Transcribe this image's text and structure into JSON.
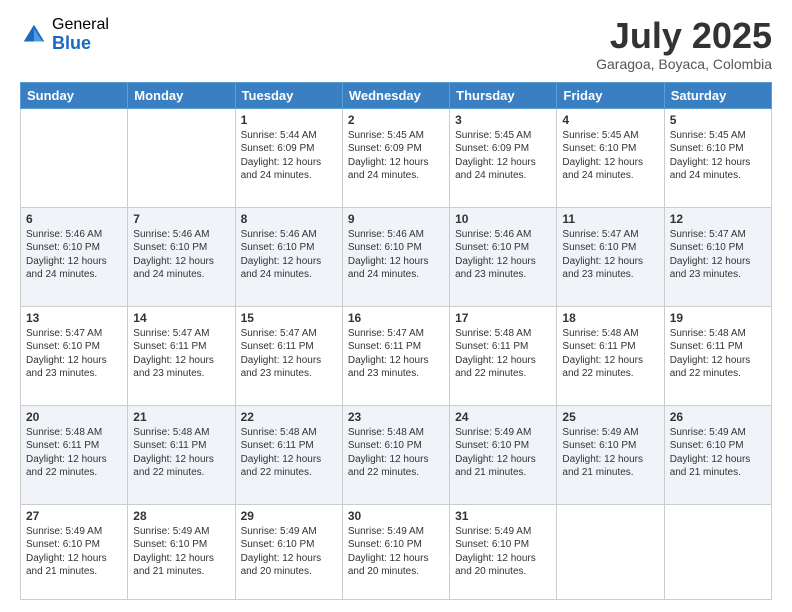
{
  "logo": {
    "general": "General",
    "blue": "Blue"
  },
  "header": {
    "month": "July 2025",
    "location": "Garagoa, Boyaca, Colombia"
  },
  "days_of_week": [
    "Sunday",
    "Monday",
    "Tuesday",
    "Wednesday",
    "Thursday",
    "Friday",
    "Saturday"
  ],
  "weeks": [
    [
      {
        "day": "",
        "info": ""
      },
      {
        "day": "",
        "info": ""
      },
      {
        "day": "1",
        "info": "Sunrise: 5:44 AM\nSunset: 6:09 PM\nDaylight: 12 hours and 24 minutes."
      },
      {
        "day": "2",
        "info": "Sunrise: 5:45 AM\nSunset: 6:09 PM\nDaylight: 12 hours and 24 minutes."
      },
      {
        "day": "3",
        "info": "Sunrise: 5:45 AM\nSunset: 6:09 PM\nDaylight: 12 hours and 24 minutes."
      },
      {
        "day": "4",
        "info": "Sunrise: 5:45 AM\nSunset: 6:10 PM\nDaylight: 12 hours and 24 minutes."
      },
      {
        "day": "5",
        "info": "Sunrise: 5:45 AM\nSunset: 6:10 PM\nDaylight: 12 hours and 24 minutes."
      }
    ],
    [
      {
        "day": "6",
        "info": "Sunrise: 5:46 AM\nSunset: 6:10 PM\nDaylight: 12 hours and 24 minutes."
      },
      {
        "day": "7",
        "info": "Sunrise: 5:46 AM\nSunset: 6:10 PM\nDaylight: 12 hours and 24 minutes."
      },
      {
        "day": "8",
        "info": "Sunrise: 5:46 AM\nSunset: 6:10 PM\nDaylight: 12 hours and 24 minutes."
      },
      {
        "day": "9",
        "info": "Sunrise: 5:46 AM\nSunset: 6:10 PM\nDaylight: 12 hours and 24 minutes."
      },
      {
        "day": "10",
        "info": "Sunrise: 5:46 AM\nSunset: 6:10 PM\nDaylight: 12 hours and 23 minutes."
      },
      {
        "day": "11",
        "info": "Sunrise: 5:47 AM\nSunset: 6:10 PM\nDaylight: 12 hours and 23 minutes."
      },
      {
        "day": "12",
        "info": "Sunrise: 5:47 AM\nSunset: 6:10 PM\nDaylight: 12 hours and 23 minutes."
      }
    ],
    [
      {
        "day": "13",
        "info": "Sunrise: 5:47 AM\nSunset: 6:10 PM\nDaylight: 12 hours and 23 minutes."
      },
      {
        "day": "14",
        "info": "Sunrise: 5:47 AM\nSunset: 6:11 PM\nDaylight: 12 hours and 23 minutes."
      },
      {
        "day": "15",
        "info": "Sunrise: 5:47 AM\nSunset: 6:11 PM\nDaylight: 12 hours and 23 minutes."
      },
      {
        "day": "16",
        "info": "Sunrise: 5:47 AM\nSunset: 6:11 PM\nDaylight: 12 hours and 23 minutes."
      },
      {
        "day": "17",
        "info": "Sunrise: 5:48 AM\nSunset: 6:11 PM\nDaylight: 12 hours and 22 minutes."
      },
      {
        "day": "18",
        "info": "Sunrise: 5:48 AM\nSunset: 6:11 PM\nDaylight: 12 hours and 22 minutes."
      },
      {
        "day": "19",
        "info": "Sunrise: 5:48 AM\nSunset: 6:11 PM\nDaylight: 12 hours and 22 minutes."
      }
    ],
    [
      {
        "day": "20",
        "info": "Sunrise: 5:48 AM\nSunset: 6:11 PM\nDaylight: 12 hours and 22 minutes."
      },
      {
        "day": "21",
        "info": "Sunrise: 5:48 AM\nSunset: 6:11 PM\nDaylight: 12 hours and 22 minutes."
      },
      {
        "day": "22",
        "info": "Sunrise: 5:48 AM\nSunset: 6:11 PM\nDaylight: 12 hours and 22 minutes."
      },
      {
        "day": "23",
        "info": "Sunrise: 5:48 AM\nSunset: 6:10 PM\nDaylight: 12 hours and 22 minutes."
      },
      {
        "day": "24",
        "info": "Sunrise: 5:49 AM\nSunset: 6:10 PM\nDaylight: 12 hours and 21 minutes."
      },
      {
        "day": "25",
        "info": "Sunrise: 5:49 AM\nSunset: 6:10 PM\nDaylight: 12 hours and 21 minutes."
      },
      {
        "day": "26",
        "info": "Sunrise: 5:49 AM\nSunset: 6:10 PM\nDaylight: 12 hours and 21 minutes."
      }
    ],
    [
      {
        "day": "27",
        "info": "Sunrise: 5:49 AM\nSunset: 6:10 PM\nDaylight: 12 hours and 21 minutes."
      },
      {
        "day": "28",
        "info": "Sunrise: 5:49 AM\nSunset: 6:10 PM\nDaylight: 12 hours and 21 minutes."
      },
      {
        "day": "29",
        "info": "Sunrise: 5:49 AM\nSunset: 6:10 PM\nDaylight: 12 hours and 20 minutes."
      },
      {
        "day": "30",
        "info": "Sunrise: 5:49 AM\nSunset: 6:10 PM\nDaylight: 12 hours and 20 minutes."
      },
      {
        "day": "31",
        "info": "Sunrise: 5:49 AM\nSunset: 6:10 PM\nDaylight: 12 hours and 20 minutes."
      },
      {
        "day": "",
        "info": ""
      },
      {
        "day": "",
        "info": ""
      }
    ]
  ]
}
